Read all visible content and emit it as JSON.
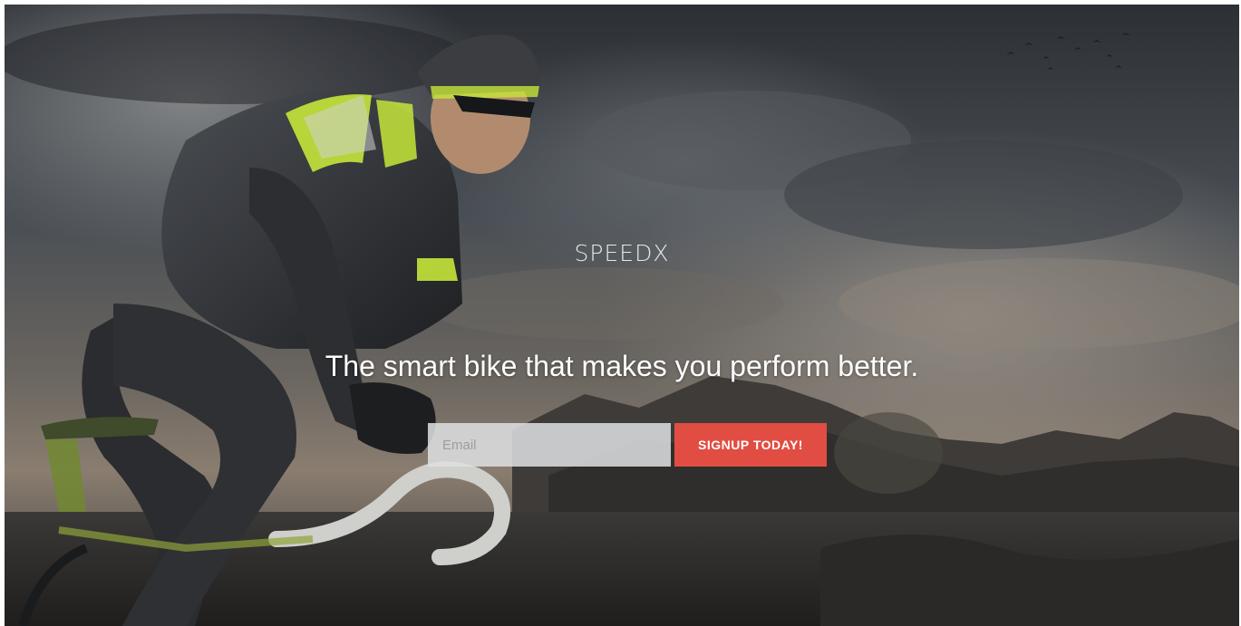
{
  "hero": {
    "brand": "SPEEDX",
    "tagline": "The smart bike that makes you perform better."
  },
  "signup": {
    "email_placeholder": "Email",
    "button_label": "SIGNUP TODAY!"
  },
  "colors": {
    "accent": "#e14d43",
    "jersey_highlight": "#c5e63a"
  }
}
